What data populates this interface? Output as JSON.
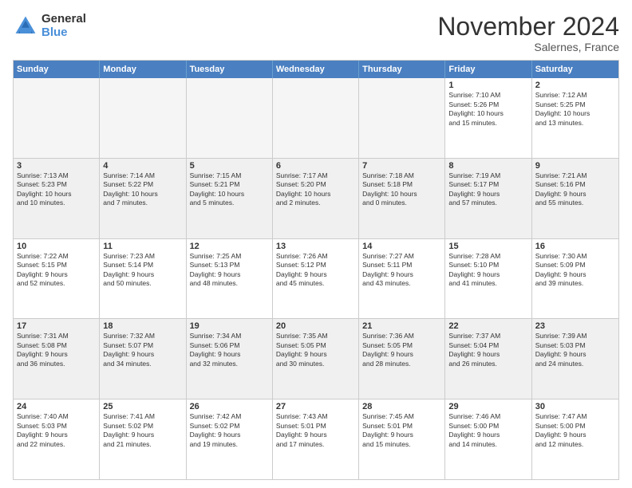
{
  "logo": {
    "general": "General",
    "blue": "Blue"
  },
  "header": {
    "month": "November 2024",
    "location": "Salernes, France"
  },
  "weekdays": [
    "Sunday",
    "Monday",
    "Tuesday",
    "Wednesday",
    "Thursday",
    "Friday",
    "Saturday"
  ],
  "rows": [
    [
      {
        "day": "",
        "info": ""
      },
      {
        "day": "",
        "info": ""
      },
      {
        "day": "",
        "info": ""
      },
      {
        "day": "",
        "info": ""
      },
      {
        "day": "",
        "info": ""
      },
      {
        "day": "1",
        "info": "Sunrise: 7:10 AM\nSunset: 5:26 PM\nDaylight: 10 hours\nand 15 minutes."
      },
      {
        "day": "2",
        "info": "Sunrise: 7:12 AM\nSunset: 5:25 PM\nDaylight: 10 hours\nand 13 minutes."
      }
    ],
    [
      {
        "day": "3",
        "info": "Sunrise: 7:13 AM\nSunset: 5:23 PM\nDaylight: 10 hours\nand 10 minutes."
      },
      {
        "day": "4",
        "info": "Sunrise: 7:14 AM\nSunset: 5:22 PM\nDaylight: 10 hours\nand 7 minutes."
      },
      {
        "day": "5",
        "info": "Sunrise: 7:15 AM\nSunset: 5:21 PM\nDaylight: 10 hours\nand 5 minutes."
      },
      {
        "day": "6",
        "info": "Sunrise: 7:17 AM\nSunset: 5:20 PM\nDaylight: 10 hours\nand 2 minutes."
      },
      {
        "day": "7",
        "info": "Sunrise: 7:18 AM\nSunset: 5:18 PM\nDaylight: 10 hours\nand 0 minutes."
      },
      {
        "day": "8",
        "info": "Sunrise: 7:19 AM\nSunset: 5:17 PM\nDaylight: 9 hours\nand 57 minutes."
      },
      {
        "day": "9",
        "info": "Sunrise: 7:21 AM\nSunset: 5:16 PM\nDaylight: 9 hours\nand 55 minutes."
      }
    ],
    [
      {
        "day": "10",
        "info": "Sunrise: 7:22 AM\nSunset: 5:15 PM\nDaylight: 9 hours\nand 52 minutes."
      },
      {
        "day": "11",
        "info": "Sunrise: 7:23 AM\nSunset: 5:14 PM\nDaylight: 9 hours\nand 50 minutes."
      },
      {
        "day": "12",
        "info": "Sunrise: 7:25 AM\nSunset: 5:13 PM\nDaylight: 9 hours\nand 48 minutes."
      },
      {
        "day": "13",
        "info": "Sunrise: 7:26 AM\nSunset: 5:12 PM\nDaylight: 9 hours\nand 45 minutes."
      },
      {
        "day": "14",
        "info": "Sunrise: 7:27 AM\nSunset: 5:11 PM\nDaylight: 9 hours\nand 43 minutes."
      },
      {
        "day": "15",
        "info": "Sunrise: 7:28 AM\nSunset: 5:10 PM\nDaylight: 9 hours\nand 41 minutes."
      },
      {
        "day": "16",
        "info": "Sunrise: 7:30 AM\nSunset: 5:09 PM\nDaylight: 9 hours\nand 39 minutes."
      }
    ],
    [
      {
        "day": "17",
        "info": "Sunrise: 7:31 AM\nSunset: 5:08 PM\nDaylight: 9 hours\nand 36 minutes."
      },
      {
        "day": "18",
        "info": "Sunrise: 7:32 AM\nSunset: 5:07 PM\nDaylight: 9 hours\nand 34 minutes."
      },
      {
        "day": "19",
        "info": "Sunrise: 7:34 AM\nSunset: 5:06 PM\nDaylight: 9 hours\nand 32 minutes."
      },
      {
        "day": "20",
        "info": "Sunrise: 7:35 AM\nSunset: 5:05 PM\nDaylight: 9 hours\nand 30 minutes."
      },
      {
        "day": "21",
        "info": "Sunrise: 7:36 AM\nSunset: 5:05 PM\nDaylight: 9 hours\nand 28 minutes."
      },
      {
        "day": "22",
        "info": "Sunrise: 7:37 AM\nSunset: 5:04 PM\nDaylight: 9 hours\nand 26 minutes."
      },
      {
        "day": "23",
        "info": "Sunrise: 7:39 AM\nSunset: 5:03 PM\nDaylight: 9 hours\nand 24 minutes."
      }
    ],
    [
      {
        "day": "24",
        "info": "Sunrise: 7:40 AM\nSunset: 5:03 PM\nDaylight: 9 hours\nand 22 minutes."
      },
      {
        "day": "25",
        "info": "Sunrise: 7:41 AM\nSunset: 5:02 PM\nDaylight: 9 hours\nand 21 minutes."
      },
      {
        "day": "26",
        "info": "Sunrise: 7:42 AM\nSunset: 5:02 PM\nDaylight: 9 hours\nand 19 minutes."
      },
      {
        "day": "27",
        "info": "Sunrise: 7:43 AM\nSunset: 5:01 PM\nDaylight: 9 hours\nand 17 minutes."
      },
      {
        "day": "28",
        "info": "Sunrise: 7:45 AM\nSunset: 5:01 PM\nDaylight: 9 hours\nand 15 minutes."
      },
      {
        "day": "29",
        "info": "Sunrise: 7:46 AM\nSunset: 5:00 PM\nDaylight: 9 hours\nand 14 minutes."
      },
      {
        "day": "30",
        "info": "Sunrise: 7:47 AM\nSunset: 5:00 PM\nDaylight: 9 hours\nand 12 minutes."
      }
    ]
  ]
}
